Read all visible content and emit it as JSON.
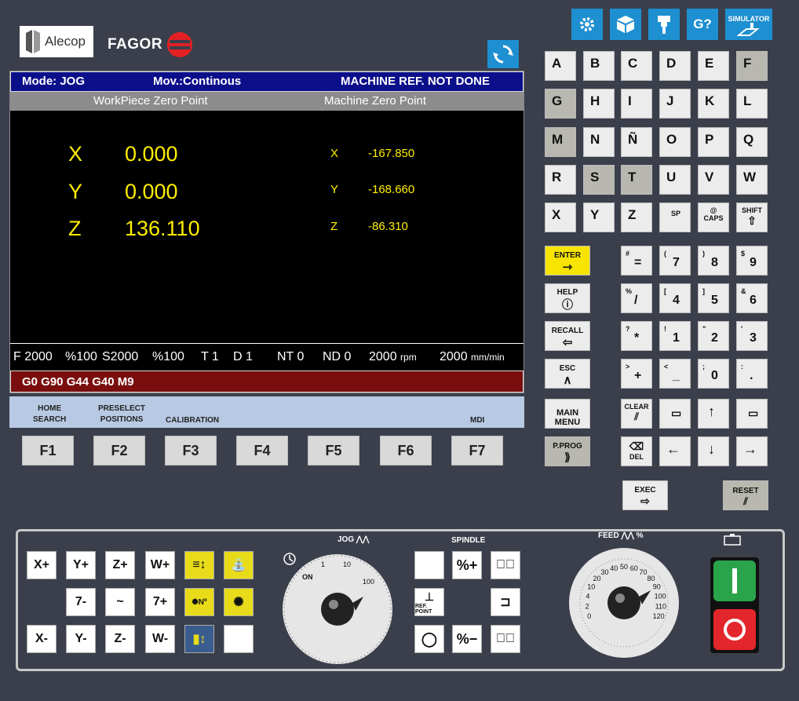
{
  "logos": {
    "alecop": "Alecop",
    "fagor": "FAGOR"
  },
  "top_icons": {
    "help": "G?",
    "simulator": "SIMULATOR"
  },
  "status": {
    "mode": "Mode: JOG",
    "mov": "Mov.:Continous",
    "ref": "MACHINE REF. NOT DONE"
  },
  "subheader": {
    "left": "WorkPiece Zero Point",
    "right": "Machine Zero Point"
  },
  "workpiece": [
    {
      "axis": "X",
      "value": "0.000"
    },
    {
      "axis": "Y",
      "value": "0.000"
    },
    {
      "axis": "Z",
      "value": "136.110"
    }
  ],
  "machine": [
    {
      "axis": "X",
      "value": "-167.850"
    },
    {
      "axis": "Y",
      "value": "-168.660"
    },
    {
      "axis": "Z",
      "value": "-86.310"
    }
  ],
  "feedbar": {
    "f": "F 2000",
    "fpct": "%100",
    "s": "S2000",
    "spct": "%100",
    "t": "T 1",
    "d": "D 1",
    "nt": "NT 0",
    "nd": "ND 0",
    "rpm_val": "2000",
    "rpm_unit": "rpm",
    "mm_val": "2000",
    "mm_unit": "mm/min"
  },
  "gcodes": "G0 G90 G44 G40 M9",
  "softkeys": {
    "home1": "HOME",
    "home2": "SEARCH",
    "pre1": "PRESELECT",
    "pre2": "POSITIONS",
    "cal": "CALIBRATION",
    "mdi": "MDI"
  },
  "fkeys": [
    "F1",
    "F2",
    "F3",
    "F4",
    "F5",
    "F6",
    "F7"
  ],
  "letters": [
    "A",
    "B",
    "C",
    "D",
    "E",
    "F",
    "G",
    "H",
    "I",
    "J",
    "K",
    "L",
    "M",
    "N",
    "Ñ",
    "O",
    "P",
    "Q",
    "R",
    "S",
    "T",
    "U",
    "V",
    "W",
    "X",
    "Y",
    "Z"
  ],
  "special": {
    "sp": "SP",
    "caps_top": "@",
    "caps": "CAPS",
    "shift": "SHIFT"
  },
  "cmd": {
    "enter": "ENTER",
    "help": "HELP",
    "recall": "RECALL",
    "esc": "ESC",
    "main1": "MAIN",
    "main2": "MENU",
    "pprog": "P.PROG",
    "clear": "CLEAR",
    "del": "DEL",
    "exec": "EXEC",
    "reset": "RESET"
  },
  "numpad": [
    {
      "sup": "#",
      "main": "="
    },
    {
      "sup": "(",
      "main": "7"
    },
    {
      "sup": ")",
      "main": "8"
    },
    {
      "sup": "$",
      "main": "9"
    },
    {
      "sup": "%",
      "main": "/"
    },
    {
      "sup": "[",
      "main": "4"
    },
    {
      "sup": "]",
      "main": "5"
    },
    {
      "sup": "&",
      "main": "6"
    },
    {
      "sup": "?",
      "main": "*"
    },
    {
      "sup": "!",
      "main": "1"
    },
    {
      "sup": "\"",
      "main": "2"
    },
    {
      "sup": "'",
      "main": "3"
    },
    {
      "sup": ">",
      "main": "+"
    },
    {
      "sup": "<",
      "main": "_"
    },
    {
      "sup": ";",
      "main": "0"
    },
    {
      "sup": ":",
      "main": "."
    }
  ],
  "jog": {
    "xp": "X+",
    "yp": "Y+",
    "zp": "Z+",
    "wp": "W+",
    "sevenm": "7-",
    "wave": "~",
    "sevenp": "7+",
    "xm": "X-",
    "ym": "Y-",
    "zm": "Z-",
    "wm": "W-",
    "nr": "Nº"
  },
  "dial_jog": {
    "label": "JOG",
    "on": "ON",
    "t1": "1",
    "t10": "10",
    "t100": "100"
  },
  "spindle": {
    "label": "SPINDLE",
    "plus": "%+",
    "minus": "%−",
    "ref": "REF. POINT"
  },
  "dial_feed": {
    "label": "FEED",
    "pct": "%",
    "ticks": [
      "0",
      "2",
      "4",
      "10",
      "20",
      "30",
      "40",
      "50",
      "60",
      "70",
      "80",
      "90",
      "100",
      "110",
      "120"
    ]
  }
}
